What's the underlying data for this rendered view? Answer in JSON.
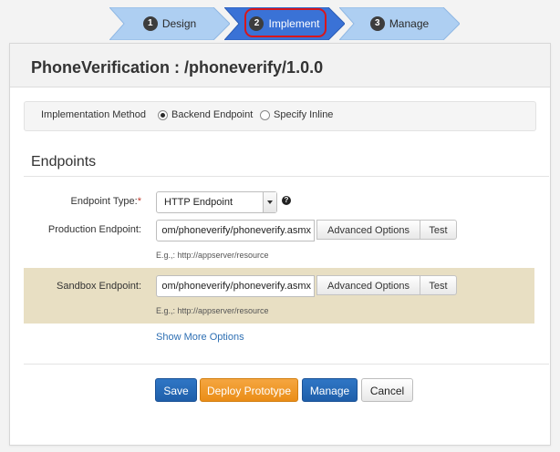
{
  "wizard": {
    "steps": [
      {
        "number": "1",
        "label": "Design",
        "state": "inactive"
      },
      {
        "number": "2",
        "label": "Implement",
        "state": "active"
      },
      {
        "number": "3",
        "label": "Manage",
        "state": "inactive"
      }
    ]
  },
  "page": {
    "title": "PhoneVerification : /phoneverify/1.0.0"
  },
  "implementation": {
    "label": "Implementation Method",
    "options": [
      {
        "label": "Backend Endpoint",
        "selected": true
      },
      {
        "label": "Specify Inline",
        "selected": false
      }
    ]
  },
  "endpoints": {
    "section_title": "Endpoints",
    "type_label": "Endpoint Type:",
    "type_required_mark": "*",
    "type_value": "HTTP Endpoint",
    "help_glyph": "?",
    "production": {
      "label": "Production Endpoint:",
      "value": "om/phoneverify/phoneverify.asmx",
      "advanced_label": "Advanced Options",
      "test_label": "Test",
      "hint": "E.g.,: http://appserver/resource"
    },
    "sandbox": {
      "label": "Sandbox Endpoint:",
      "value": "om/phoneverify/phoneverify.asmx",
      "advanced_label": "Advanced Options",
      "test_label": "Test",
      "hint": "E.g.,: http://appserver/resource"
    },
    "show_more_label": "Show More Options"
  },
  "actions": {
    "save_label": "Save",
    "deploy_label": "Deploy Prototype",
    "manage_label": "Manage",
    "cancel_label": "Cancel"
  },
  "colors": {
    "step_active": "#3a72d6",
    "step_inactive": "#aecff2",
    "highlight": "#d8161b",
    "sandbox_band": "#e8dfc3",
    "primary": "#2468b8",
    "warning": "#ee951f",
    "link": "#2e6fb3"
  }
}
